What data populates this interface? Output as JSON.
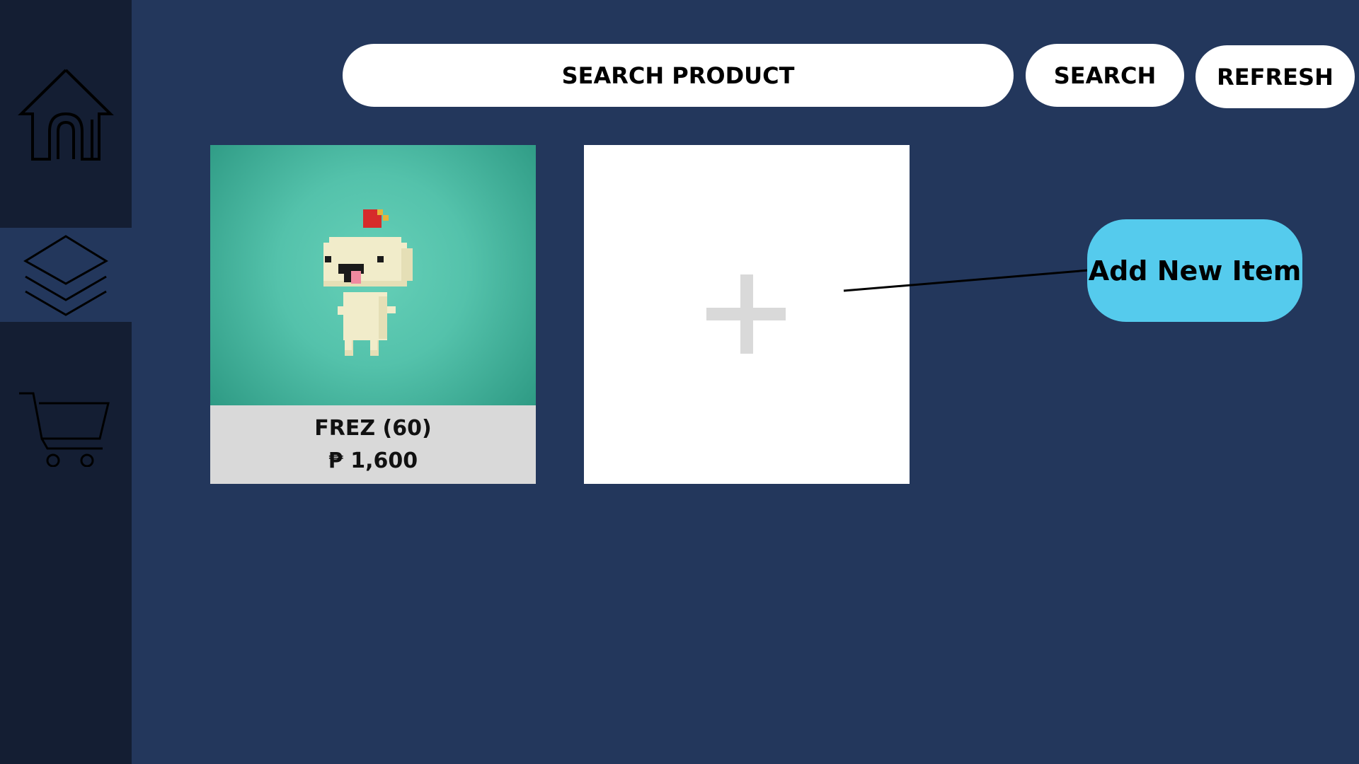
{
  "sidebar": {
    "items": [
      {
        "name": "home",
        "icon": "home-icon",
        "active": false
      },
      {
        "name": "products",
        "icon": "layers-icon",
        "active": true
      },
      {
        "name": "cart",
        "icon": "shopping-cart-icon",
        "active": false
      }
    ]
  },
  "search": {
    "placeholder": "SEARCH PRODUCT",
    "button_label": "SEARCH"
  },
  "toolbar": {
    "refresh_label": "REFRESH"
  },
  "products": [
    {
      "name": "FREZ (60)",
      "price": "₱ 1,600",
      "image": "pixel-character-image"
    }
  ],
  "add_card": {
    "icon": "plus-icon"
  },
  "callout": {
    "label": "Add New Item"
  },
  "colors": {
    "background": "#23375c",
    "sidebar": "#141e33",
    "callout": "#55cbed",
    "card_caption": "#d9d9d9"
  }
}
